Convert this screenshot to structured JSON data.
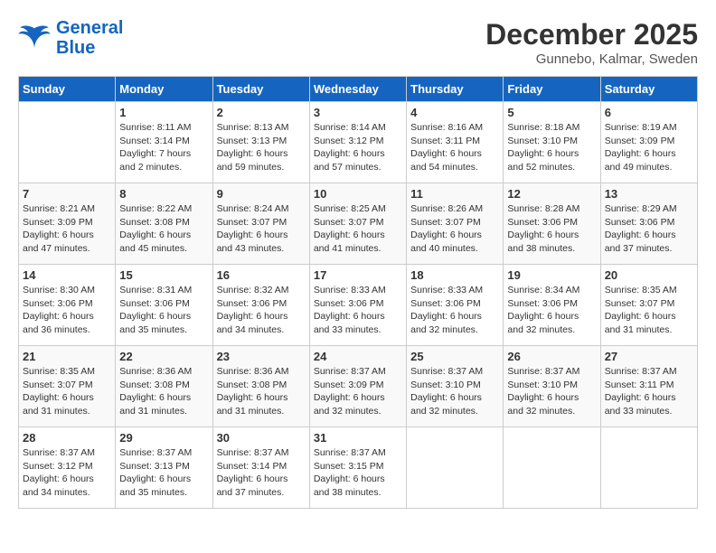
{
  "header": {
    "logo_line1": "General",
    "logo_line2": "Blue",
    "month_title": "December 2025",
    "location": "Gunnebo, Kalmar, Sweden"
  },
  "days_of_week": [
    "Sunday",
    "Monday",
    "Tuesday",
    "Wednesday",
    "Thursday",
    "Friday",
    "Saturday"
  ],
  "weeks": [
    [
      {
        "day": "",
        "info": ""
      },
      {
        "day": "1",
        "info": "Sunrise: 8:11 AM\nSunset: 3:14 PM\nDaylight: 7 hours\nand 2 minutes."
      },
      {
        "day": "2",
        "info": "Sunrise: 8:13 AM\nSunset: 3:13 PM\nDaylight: 6 hours\nand 59 minutes."
      },
      {
        "day": "3",
        "info": "Sunrise: 8:14 AM\nSunset: 3:12 PM\nDaylight: 6 hours\nand 57 minutes."
      },
      {
        "day": "4",
        "info": "Sunrise: 8:16 AM\nSunset: 3:11 PM\nDaylight: 6 hours\nand 54 minutes."
      },
      {
        "day": "5",
        "info": "Sunrise: 8:18 AM\nSunset: 3:10 PM\nDaylight: 6 hours\nand 52 minutes."
      },
      {
        "day": "6",
        "info": "Sunrise: 8:19 AM\nSunset: 3:09 PM\nDaylight: 6 hours\nand 49 minutes."
      }
    ],
    [
      {
        "day": "7",
        "info": "Sunrise: 8:21 AM\nSunset: 3:09 PM\nDaylight: 6 hours\nand 47 minutes."
      },
      {
        "day": "8",
        "info": "Sunrise: 8:22 AM\nSunset: 3:08 PM\nDaylight: 6 hours\nand 45 minutes."
      },
      {
        "day": "9",
        "info": "Sunrise: 8:24 AM\nSunset: 3:07 PM\nDaylight: 6 hours\nand 43 minutes."
      },
      {
        "day": "10",
        "info": "Sunrise: 8:25 AM\nSunset: 3:07 PM\nDaylight: 6 hours\nand 41 minutes."
      },
      {
        "day": "11",
        "info": "Sunrise: 8:26 AM\nSunset: 3:07 PM\nDaylight: 6 hours\nand 40 minutes."
      },
      {
        "day": "12",
        "info": "Sunrise: 8:28 AM\nSunset: 3:06 PM\nDaylight: 6 hours\nand 38 minutes."
      },
      {
        "day": "13",
        "info": "Sunrise: 8:29 AM\nSunset: 3:06 PM\nDaylight: 6 hours\nand 37 minutes."
      }
    ],
    [
      {
        "day": "14",
        "info": "Sunrise: 8:30 AM\nSunset: 3:06 PM\nDaylight: 6 hours\nand 36 minutes."
      },
      {
        "day": "15",
        "info": "Sunrise: 8:31 AM\nSunset: 3:06 PM\nDaylight: 6 hours\nand 35 minutes."
      },
      {
        "day": "16",
        "info": "Sunrise: 8:32 AM\nSunset: 3:06 PM\nDaylight: 6 hours\nand 34 minutes."
      },
      {
        "day": "17",
        "info": "Sunrise: 8:33 AM\nSunset: 3:06 PM\nDaylight: 6 hours\nand 33 minutes."
      },
      {
        "day": "18",
        "info": "Sunrise: 8:33 AM\nSunset: 3:06 PM\nDaylight: 6 hours\nand 32 minutes."
      },
      {
        "day": "19",
        "info": "Sunrise: 8:34 AM\nSunset: 3:06 PM\nDaylight: 6 hours\nand 32 minutes."
      },
      {
        "day": "20",
        "info": "Sunrise: 8:35 AM\nSunset: 3:07 PM\nDaylight: 6 hours\nand 31 minutes."
      }
    ],
    [
      {
        "day": "21",
        "info": "Sunrise: 8:35 AM\nSunset: 3:07 PM\nDaylight: 6 hours\nand 31 minutes."
      },
      {
        "day": "22",
        "info": "Sunrise: 8:36 AM\nSunset: 3:08 PM\nDaylight: 6 hours\nand 31 minutes."
      },
      {
        "day": "23",
        "info": "Sunrise: 8:36 AM\nSunset: 3:08 PM\nDaylight: 6 hours\nand 31 minutes."
      },
      {
        "day": "24",
        "info": "Sunrise: 8:37 AM\nSunset: 3:09 PM\nDaylight: 6 hours\nand 32 minutes."
      },
      {
        "day": "25",
        "info": "Sunrise: 8:37 AM\nSunset: 3:10 PM\nDaylight: 6 hours\nand 32 minutes."
      },
      {
        "day": "26",
        "info": "Sunrise: 8:37 AM\nSunset: 3:10 PM\nDaylight: 6 hours\nand 32 minutes."
      },
      {
        "day": "27",
        "info": "Sunrise: 8:37 AM\nSunset: 3:11 PM\nDaylight: 6 hours\nand 33 minutes."
      }
    ],
    [
      {
        "day": "28",
        "info": "Sunrise: 8:37 AM\nSunset: 3:12 PM\nDaylight: 6 hours\nand 34 minutes."
      },
      {
        "day": "29",
        "info": "Sunrise: 8:37 AM\nSunset: 3:13 PM\nDaylight: 6 hours\nand 35 minutes."
      },
      {
        "day": "30",
        "info": "Sunrise: 8:37 AM\nSunset: 3:14 PM\nDaylight: 6 hours\nand 37 minutes."
      },
      {
        "day": "31",
        "info": "Sunrise: 8:37 AM\nSunset: 3:15 PM\nDaylight: 6 hours\nand 38 minutes."
      },
      {
        "day": "",
        "info": ""
      },
      {
        "day": "",
        "info": ""
      },
      {
        "day": "",
        "info": ""
      }
    ]
  ]
}
